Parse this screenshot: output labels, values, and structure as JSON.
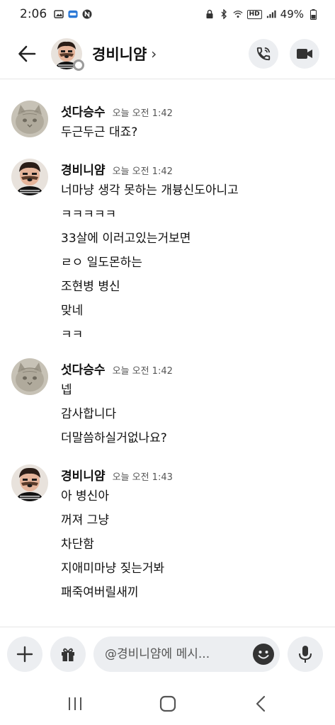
{
  "status_bar": {
    "time": "2:06",
    "battery": "49%",
    "network_badge": "HD"
  },
  "header": {
    "back_icon": "arrow-left-icon",
    "title": "경비니얌",
    "title_chevron": "›",
    "voice_call_icon": "phone-icon",
    "video_call_icon": "video-camera-icon"
  },
  "messages": [
    {
      "sender": "섯다승수",
      "time": "오늘 오전 1:42",
      "avatar": "cat-avatar",
      "lines": [
        "두근두근 대죠?"
      ]
    },
    {
      "sender": "경비니얌",
      "time": "오늘 오전 1:42",
      "avatar": "person-avatar",
      "lines": [
        "너마냥 생각 못하는 개븅신도아니고",
        "ㅋㅋㅋㅋㅋ",
        "33살에 이러고있는거보면",
        "ㄹㅇ 일도몬하는",
        "조현병 병신",
        "맞네",
        "ㅋㅋ"
      ]
    },
    {
      "sender": "섯다승수",
      "time": "오늘 오전 1:42",
      "avatar": "cat-avatar",
      "lines": [
        "넵",
        "감사합니다",
        "더말씀하실거없나요?"
      ]
    },
    {
      "sender": "경비니얌",
      "time": "오늘 오전 1:43",
      "avatar": "person-avatar",
      "lines": [
        "아 병신아",
        "꺼져 그냥",
        "차단함",
        "지애미마냥 짖는거봐",
        "패죽여버릴새끼"
      ]
    }
  ],
  "composer": {
    "placeholder": "@경비니얌에 메시...",
    "add_icon": "plus-icon",
    "gift_icon": "gift-icon",
    "emoji_icon": "emoji-icon",
    "mic_icon": "microphone-icon"
  },
  "navbar": {
    "recents_icon": "recents-icon",
    "home_icon": "home-icon",
    "back_icon": "nav-back-icon"
  },
  "colors": {
    "button_bg": "#eceef1",
    "text": "#111111",
    "muted": "#555555"
  }
}
